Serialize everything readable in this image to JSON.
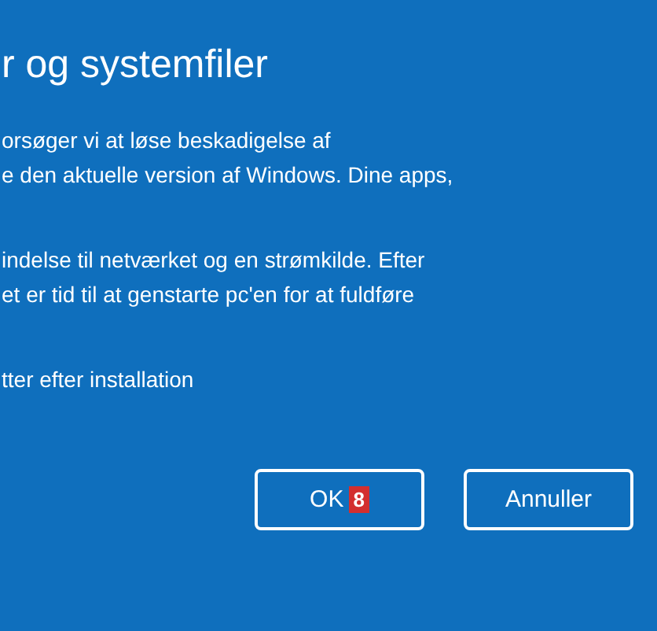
{
  "dialog": {
    "title": "r og systemfiler",
    "paragraphs": [
      [
        "orsøger vi at løse beskadigelse af",
        "e den aktuelle version af Windows. Dine apps,"
      ],
      [
        "indelse til netværket og en strømkilde. Efter",
        "et er tid til at genstarte pc'en for at fuldføre"
      ],
      [
        "tter efter installation"
      ]
    ],
    "buttons": [
      {
        "label": "OK",
        "badge": "8"
      },
      {
        "label": "Annuller"
      }
    ]
  }
}
